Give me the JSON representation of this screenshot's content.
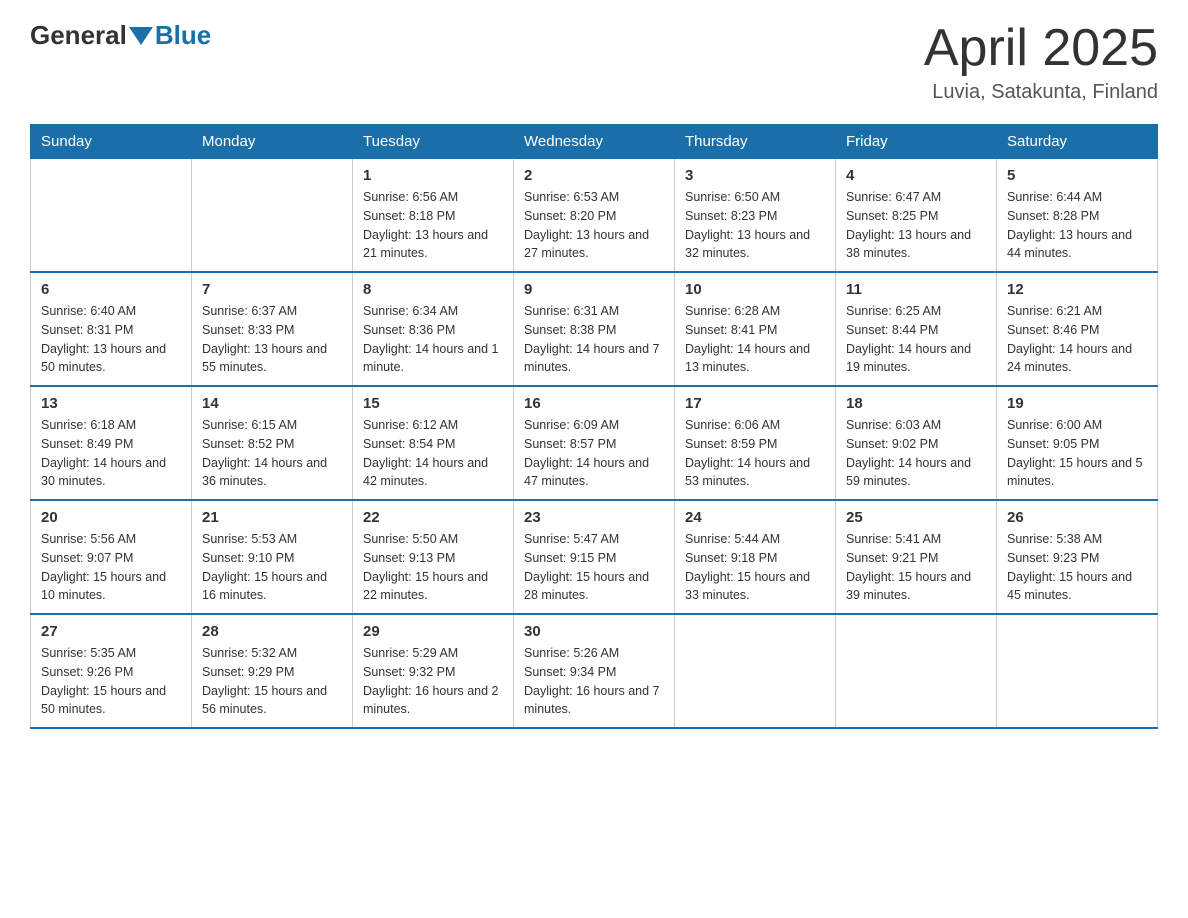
{
  "header": {
    "logo_general": "General",
    "logo_blue": "Blue",
    "title": "April 2025",
    "subtitle": "Luvia, Satakunta, Finland"
  },
  "days_of_week": [
    "Sunday",
    "Monday",
    "Tuesday",
    "Wednesday",
    "Thursday",
    "Friday",
    "Saturday"
  ],
  "weeks": [
    [
      {
        "day": "",
        "sunrise": "",
        "sunset": "",
        "daylight": ""
      },
      {
        "day": "",
        "sunrise": "",
        "sunset": "",
        "daylight": ""
      },
      {
        "day": "1",
        "sunrise": "Sunrise: 6:56 AM",
        "sunset": "Sunset: 8:18 PM",
        "daylight": "Daylight: 13 hours and 21 minutes."
      },
      {
        "day": "2",
        "sunrise": "Sunrise: 6:53 AM",
        "sunset": "Sunset: 8:20 PM",
        "daylight": "Daylight: 13 hours and 27 minutes."
      },
      {
        "day": "3",
        "sunrise": "Sunrise: 6:50 AM",
        "sunset": "Sunset: 8:23 PM",
        "daylight": "Daylight: 13 hours and 32 minutes."
      },
      {
        "day": "4",
        "sunrise": "Sunrise: 6:47 AM",
        "sunset": "Sunset: 8:25 PM",
        "daylight": "Daylight: 13 hours and 38 minutes."
      },
      {
        "day": "5",
        "sunrise": "Sunrise: 6:44 AM",
        "sunset": "Sunset: 8:28 PM",
        "daylight": "Daylight: 13 hours and 44 minutes."
      }
    ],
    [
      {
        "day": "6",
        "sunrise": "Sunrise: 6:40 AM",
        "sunset": "Sunset: 8:31 PM",
        "daylight": "Daylight: 13 hours and 50 minutes."
      },
      {
        "day": "7",
        "sunrise": "Sunrise: 6:37 AM",
        "sunset": "Sunset: 8:33 PM",
        "daylight": "Daylight: 13 hours and 55 minutes."
      },
      {
        "day": "8",
        "sunrise": "Sunrise: 6:34 AM",
        "sunset": "Sunset: 8:36 PM",
        "daylight": "Daylight: 14 hours and 1 minute."
      },
      {
        "day": "9",
        "sunrise": "Sunrise: 6:31 AM",
        "sunset": "Sunset: 8:38 PM",
        "daylight": "Daylight: 14 hours and 7 minutes."
      },
      {
        "day": "10",
        "sunrise": "Sunrise: 6:28 AM",
        "sunset": "Sunset: 8:41 PM",
        "daylight": "Daylight: 14 hours and 13 minutes."
      },
      {
        "day": "11",
        "sunrise": "Sunrise: 6:25 AM",
        "sunset": "Sunset: 8:44 PM",
        "daylight": "Daylight: 14 hours and 19 minutes."
      },
      {
        "day": "12",
        "sunrise": "Sunrise: 6:21 AM",
        "sunset": "Sunset: 8:46 PM",
        "daylight": "Daylight: 14 hours and 24 minutes."
      }
    ],
    [
      {
        "day": "13",
        "sunrise": "Sunrise: 6:18 AM",
        "sunset": "Sunset: 8:49 PM",
        "daylight": "Daylight: 14 hours and 30 minutes."
      },
      {
        "day": "14",
        "sunrise": "Sunrise: 6:15 AM",
        "sunset": "Sunset: 8:52 PM",
        "daylight": "Daylight: 14 hours and 36 minutes."
      },
      {
        "day": "15",
        "sunrise": "Sunrise: 6:12 AM",
        "sunset": "Sunset: 8:54 PM",
        "daylight": "Daylight: 14 hours and 42 minutes."
      },
      {
        "day": "16",
        "sunrise": "Sunrise: 6:09 AM",
        "sunset": "Sunset: 8:57 PM",
        "daylight": "Daylight: 14 hours and 47 minutes."
      },
      {
        "day": "17",
        "sunrise": "Sunrise: 6:06 AM",
        "sunset": "Sunset: 8:59 PM",
        "daylight": "Daylight: 14 hours and 53 minutes."
      },
      {
        "day": "18",
        "sunrise": "Sunrise: 6:03 AM",
        "sunset": "Sunset: 9:02 PM",
        "daylight": "Daylight: 14 hours and 59 minutes."
      },
      {
        "day": "19",
        "sunrise": "Sunrise: 6:00 AM",
        "sunset": "Sunset: 9:05 PM",
        "daylight": "Daylight: 15 hours and 5 minutes."
      }
    ],
    [
      {
        "day": "20",
        "sunrise": "Sunrise: 5:56 AM",
        "sunset": "Sunset: 9:07 PM",
        "daylight": "Daylight: 15 hours and 10 minutes."
      },
      {
        "day": "21",
        "sunrise": "Sunrise: 5:53 AM",
        "sunset": "Sunset: 9:10 PM",
        "daylight": "Daylight: 15 hours and 16 minutes."
      },
      {
        "day": "22",
        "sunrise": "Sunrise: 5:50 AM",
        "sunset": "Sunset: 9:13 PM",
        "daylight": "Daylight: 15 hours and 22 minutes."
      },
      {
        "day": "23",
        "sunrise": "Sunrise: 5:47 AM",
        "sunset": "Sunset: 9:15 PM",
        "daylight": "Daylight: 15 hours and 28 minutes."
      },
      {
        "day": "24",
        "sunrise": "Sunrise: 5:44 AM",
        "sunset": "Sunset: 9:18 PM",
        "daylight": "Daylight: 15 hours and 33 minutes."
      },
      {
        "day": "25",
        "sunrise": "Sunrise: 5:41 AM",
        "sunset": "Sunset: 9:21 PM",
        "daylight": "Daylight: 15 hours and 39 minutes."
      },
      {
        "day": "26",
        "sunrise": "Sunrise: 5:38 AM",
        "sunset": "Sunset: 9:23 PM",
        "daylight": "Daylight: 15 hours and 45 minutes."
      }
    ],
    [
      {
        "day": "27",
        "sunrise": "Sunrise: 5:35 AM",
        "sunset": "Sunset: 9:26 PM",
        "daylight": "Daylight: 15 hours and 50 minutes."
      },
      {
        "day": "28",
        "sunrise": "Sunrise: 5:32 AM",
        "sunset": "Sunset: 9:29 PM",
        "daylight": "Daylight: 15 hours and 56 minutes."
      },
      {
        "day": "29",
        "sunrise": "Sunrise: 5:29 AM",
        "sunset": "Sunset: 9:32 PM",
        "daylight": "Daylight: 16 hours and 2 minutes."
      },
      {
        "day": "30",
        "sunrise": "Sunrise: 5:26 AM",
        "sunset": "Sunset: 9:34 PM",
        "daylight": "Daylight: 16 hours and 7 minutes."
      },
      {
        "day": "",
        "sunrise": "",
        "sunset": "",
        "daylight": ""
      },
      {
        "day": "",
        "sunrise": "",
        "sunset": "",
        "daylight": ""
      },
      {
        "day": "",
        "sunrise": "",
        "sunset": "",
        "daylight": ""
      }
    ]
  ]
}
